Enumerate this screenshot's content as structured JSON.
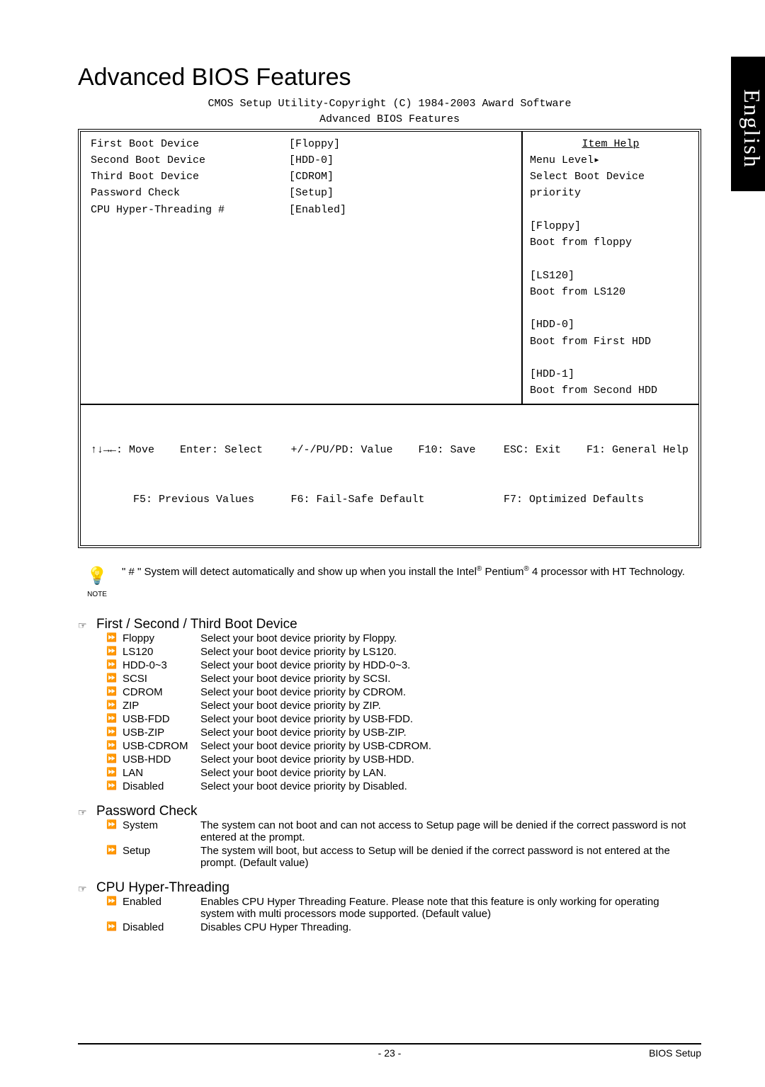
{
  "lang_tab": "English",
  "title": "Advanced BIOS Features",
  "bios_header_line1": "CMOS Setup Utility-Copyright (C) 1984-2003 Award Software",
  "bios_header_line2": "Advanced BIOS Features",
  "settings": [
    {
      "label": "First Boot Device",
      "value": "[Floppy]"
    },
    {
      "label": "Second Boot Device",
      "value": "[HDD-0]"
    },
    {
      "label": "Third Boot Device",
      "value": "[CDROM]"
    },
    {
      "label": "Password Check",
      "value": "[Setup]"
    },
    {
      "label": "CPU Hyper-Threading #",
      "value": "[Enabled]"
    }
  ],
  "help": {
    "title": "Item Help",
    "lines": [
      "Menu Level▸",
      "Select Boot Device",
      "priority",
      "",
      "[Floppy]",
      "Boot from floppy",
      "",
      "[LS120]",
      "Boot from LS120",
      "",
      "[HDD-0]",
      "Boot from First HDD",
      "",
      "[HDD-1]",
      "Boot from Second HDD"
    ]
  },
  "keys_row1_left": "↑↓→←: Move    Enter: Select",
  "keys_row1_mid": "+/-/PU/PD: Value    F10: Save",
  "keys_row1_right": "ESC: Exit    F1: General Help",
  "keys_row2_left": "F5: Previous Values",
  "keys_row2_mid": "F6: Fail-Safe Default",
  "keys_row2_right": "F7: Optimized Defaults",
  "note_icon_label": "NOTE",
  "note_text_a": "\" # \" System will detect automatically and show up when you install the Intel",
  "note_text_b": " Pentium",
  "note_text_c": " 4 processor with HT Technology.",
  "sections": [
    {
      "title": "First / Second / Third Boot Device",
      "options": [
        {
          "name": "Floppy",
          "desc": "Select your boot device priority by Floppy."
        },
        {
          "name": "LS120",
          "desc": "Select your boot device priority by LS120."
        },
        {
          "name": "HDD-0~3",
          "desc": "Select your boot device priority by HDD-0~3."
        },
        {
          "name": "SCSI",
          "desc": "Select your boot device priority by SCSI."
        },
        {
          "name": "CDROM",
          "desc": "Select your boot device priority by CDROM."
        },
        {
          "name": "ZIP",
          "desc": "Select your boot device priority by ZIP."
        },
        {
          "name": "USB-FDD",
          "desc": "Select your boot device priority by USB-FDD."
        },
        {
          "name": "USB-ZIP",
          "desc": "Select your boot device priority by USB-ZIP."
        },
        {
          "name": "USB-CDROM",
          "desc": "Select your boot device priority by USB-CDROM."
        },
        {
          "name": "USB-HDD",
          "desc": "Select your boot device priority by USB-HDD."
        },
        {
          "name": "LAN",
          "desc": "Select your boot device priority by LAN."
        },
        {
          "name": "Disabled",
          "desc": "Select your boot device priority by Disabled."
        }
      ]
    },
    {
      "title": "Password Check",
      "options": [
        {
          "name": "System",
          "desc": "The system can not boot and can not access to Setup page will be denied if the correct password is not entered at the prompt."
        },
        {
          "name": "Setup",
          "desc": "The system will boot, but access to Setup will be denied if the correct password is not entered at the prompt. (Default value)"
        }
      ]
    },
    {
      "title": "CPU Hyper-Threading",
      "options": [
        {
          "name": "Enabled",
          "desc": "Enables CPU Hyper Threading Feature. Please note that this feature is only working for operating system with multi processors mode supported. (Default value)"
        },
        {
          "name": "Disabled",
          "desc": "Disables CPU Hyper Threading."
        }
      ]
    }
  ],
  "footer": {
    "page": "- 23 -",
    "right": "BIOS Setup"
  }
}
